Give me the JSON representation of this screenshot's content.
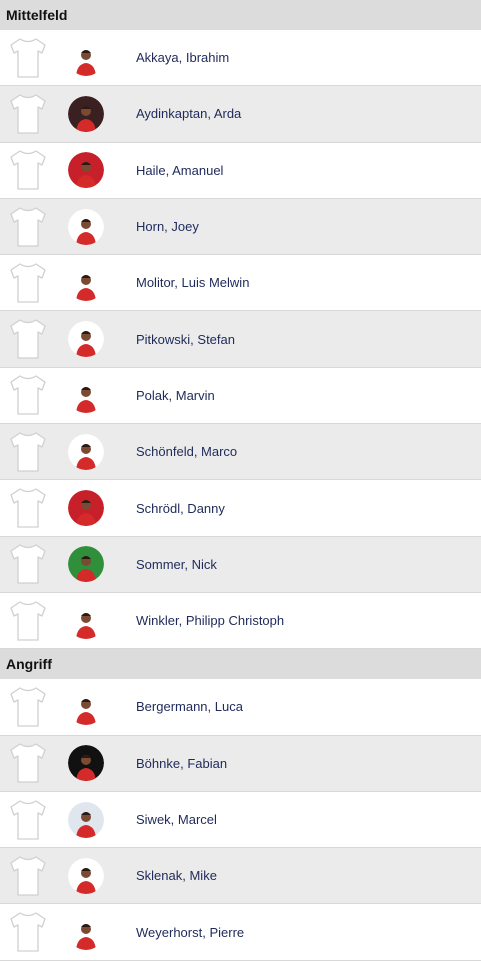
{
  "sections": [
    {
      "title": "Mittelfeld",
      "players": [
        {
          "name": "Akkaya, Ibrahim",
          "avatar_bg": "#ffffff"
        },
        {
          "name": "Aydinkaptan, Arda",
          "avatar_bg": "#3a2020"
        },
        {
          "name": "Haile, Amanuel",
          "avatar_bg": "#c8202a"
        },
        {
          "name": "Horn, Joey",
          "avatar_bg": "#ffffff"
        },
        {
          "name": "Molitor, Luis Melwin",
          "avatar_bg": "#ffffff"
        },
        {
          "name": "Pitkowski, Stefan",
          "avatar_bg": "#ffffff"
        },
        {
          "name": "Polak, Marvin",
          "avatar_bg": "#ffffff"
        },
        {
          "name": "Schönfeld, Marco",
          "avatar_bg": "#ffffff"
        },
        {
          "name": "Schrödl, Danny",
          "avatar_bg": "#c8202a"
        },
        {
          "name": "Sommer, Nick",
          "avatar_bg": "#2f8f3a"
        },
        {
          "name": "Winkler, Philipp Christoph",
          "avatar_bg": "#ffffff"
        }
      ]
    },
    {
      "title": "Angriff",
      "players": [
        {
          "name": "Bergermann, Luca",
          "avatar_bg": "#ffffff"
        },
        {
          "name": "Böhnke, Fabian",
          "avatar_bg": "#111111"
        },
        {
          "name": "Siwek, Marcel",
          "avatar_bg": "#dfe6ee"
        },
        {
          "name": "Sklenak, Mike",
          "avatar_bg": "#ffffff"
        },
        {
          "name": "Weyerhorst, Pierre",
          "avatar_bg": "#ffffff"
        }
      ]
    }
  ],
  "colors": {
    "header_bg": "#dcdcdc",
    "row_alt_bg": "#ebebeb",
    "name_text": "#1f2a5a",
    "jersey_red": "#d42a2a"
  },
  "icons": {
    "shirt": "shirt-icon",
    "avatar": "player-avatar"
  }
}
